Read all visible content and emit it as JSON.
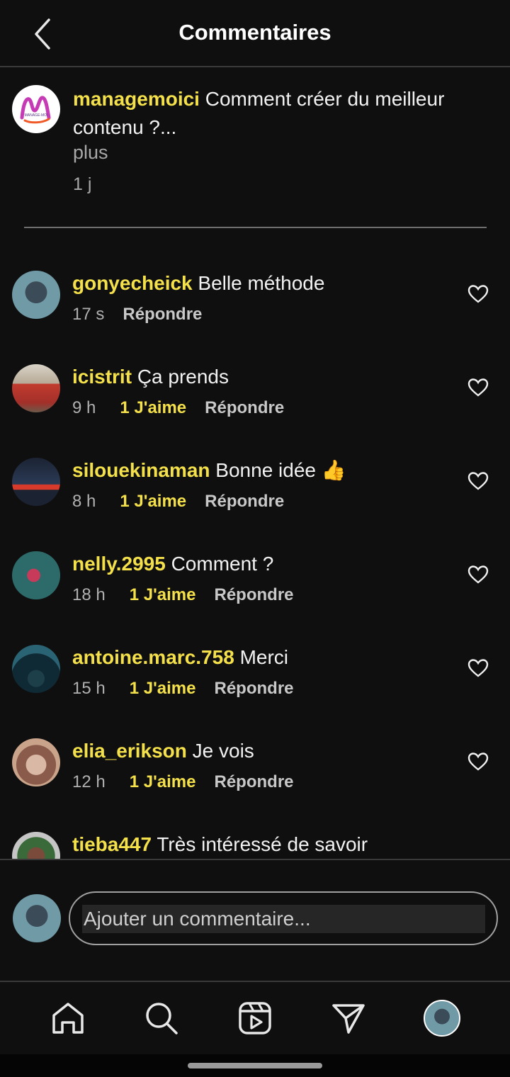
{
  "header": {
    "title": "Commentaires"
  },
  "caption": {
    "username": "managemoici",
    "text": "Comment créer du meilleur contenu ?...",
    "more": "plus",
    "time": "1 j"
  },
  "comments": [
    {
      "username": "gonyecheick",
      "text": "Belle méthode",
      "time": "17 s",
      "likes": "",
      "reply": "Répondre"
    },
    {
      "username": "icistrit",
      "text": "Ça prends",
      "time": "9 h",
      "likes": "1 J'aime",
      "reply": "Répondre"
    },
    {
      "username": "silouekinaman",
      "text": "Bonne idée 👍",
      "time": "8 h",
      "likes": "1 J'aime",
      "reply": "Répondre"
    },
    {
      "username": "nelly.2995",
      "text": "Comment ?",
      "time": "18 h",
      "likes": "1 J'aime",
      "reply": "Répondre"
    },
    {
      "username": "antoine.marc.758",
      "text": "Merci",
      "time": "15 h",
      "likes": "1 J'aime",
      "reply": "Répondre"
    },
    {
      "username": "elia_erikson",
      "text": "Je vois",
      "time": "12 h",
      "likes": "1 J'aime",
      "reply": "Répondre"
    },
    {
      "username": "tieba447",
      "text": "Très intéressé de savoir",
      "time": "",
      "likes": "",
      "reply": ""
    }
  ],
  "composer": {
    "placeholder": "Ajouter un commentaire..."
  },
  "icons": {
    "back": "chevron-left-icon",
    "heart": "heart-icon",
    "nav": [
      "home-icon",
      "search-icon",
      "reels-icon",
      "send-icon",
      "profile-avatar"
    ]
  },
  "colors": {
    "background": "#0f0f0f",
    "username": "#f3e04a",
    "likes": "#f3e04a",
    "divider": "#3a3a3a",
    "secondary_text": "#a8a8a8"
  }
}
